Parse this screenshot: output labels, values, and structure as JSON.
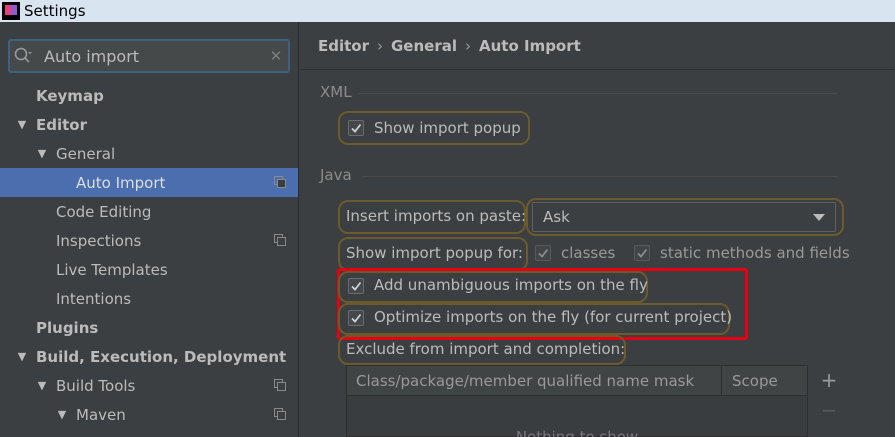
{
  "window": {
    "title": "Settings"
  },
  "search": {
    "value": "Auto import"
  },
  "tree": [
    {
      "label": "Keymap",
      "bold": true,
      "level": "lvl0n",
      "arrow": "",
      "copy": false,
      "selected": false,
      "name": "tree-item-keymap"
    },
    {
      "label": "Editor",
      "bold": true,
      "level": "lvl0",
      "arrow": "▼",
      "copy": false,
      "selected": false,
      "name": "tree-item-editor"
    },
    {
      "label": "General",
      "bold": false,
      "level": "lvl1",
      "arrow": "▼",
      "copy": false,
      "selected": false,
      "name": "tree-item-general"
    },
    {
      "label": "Auto Import",
      "bold": false,
      "level": "lvl2n",
      "arrow": "",
      "copy": true,
      "selected": true,
      "name": "tree-item-auto-import"
    },
    {
      "label": "Code Editing",
      "bold": false,
      "level": "lvl1n",
      "arrow": "",
      "copy": false,
      "selected": false,
      "name": "tree-item-code-editing"
    },
    {
      "label": "Inspections",
      "bold": false,
      "level": "lvl1n",
      "arrow": "",
      "copy": true,
      "selected": false,
      "name": "tree-item-inspections"
    },
    {
      "label": "Live Templates",
      "bold": false,
      "level": "lvl1n",
      "arrow": "",
      "copy": false,
      "selected": false,
      "name": "tree-item-live-templates"
    },
    {
      "label": "Intentions",
      "bold": false,
      "level": "lvl1n",
      "arrow": "",
      "copy": false,
      "selected": false,
      "name": "tree-item-intentions"
    },
    {
      "label": "Plugins",
      "bold": true,
      "level": "lvl0n",
      "arrow": "",
      "copy": false,
      "selected": false,
      "name": "tree-item-plugins"
    },
    {
      "label": "Build, Execution, Deployment",
      "bold": true,
      "level": "lvl0",
      "arrow": "▼",
      "copy": false,
      "selected": false,
      "name": "tree-item-build-execution-deployment"
    },
    {
      "label": "Build Tools",
      "bold": false,
      "level": "lvl1",
      "arrow": "▼",
      "copy": true,
      "selected": false,
      "name": "tree-item-build-tools"
    },
    {
      "label": "Maven",
      "bold": false,
      "level": "lvl1",
      "arrow": "▼",
      "copy": true,
      "selected": false,
      "name": "tree-item-maven",
      "indent_extra": true
    }
  ],
  "breadcrumb": {
    "part1": "Editor",
    "part2": "General",
    "part3": "Auto Import",
    "sep": "›"
  },
  "xml": {
    "section": "XML",
    "show_import_popup": {
      "label": "Show import popup",
      "checked": true
    }
  },
  "java": {
    "section": "Java",
    "insert_on_paste_label": "Insert imports on paste:",
    "insert_on_paste_value": "Ask",
    "show_popup_for_label": "Show import popup for:",
    "classes_label": "classes",
    "static_label": "static methods and fields",
    "add_unambiguous_label": "Add unambiguous imports on the fly",
    "optimize_label": "Optimize imports on the fly (for current project)",
    "exclude_label": "Exclude from import and completion:"
  },
  "exclude_table": {
    "col1": "Class/package/member qualified name mask",
    "col2": "Scope",
    "empty_text": "Nothing to show",
    "add": "+",
    "remove": "−"
  },
  "colors": {
    "selection": "#4b6eaf",
    "highlight_box": "#e60012",
    "focus_glow": "#6b5a2c"
  }
}
